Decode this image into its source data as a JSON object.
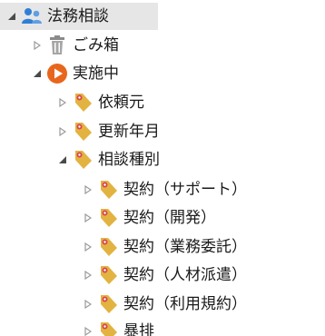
{
  "tree": {
    "root": {
      "label": "法務相談",
      "expanded": true,
      "icon": "users-icon"
    },
    "children": [
      {
        "label": "ごみ箱",
        "expanded": false,
        "icon": "trash-icon"
      },
      {
        "label": "実施中",
        "expanded": true,
        "icon": "play-circle-icon"
      }
    ],
    "active_children": [
      {
        "label": "依頼元",
        "expanded": false,
        "icon": "tag-icon"
      },
      {
        "label": "更新年月",
        "expanded": false,
        "icon": "tag-icon"
      },
      {
        "label": "相談種別",
        "expanded": true,
        "icon": "tag-icon"
      }
    ],
    "consult_types": [
      {
        "label": "契約（サポート）",
        "icon": "tag-icon"
      },
      {
        "label": "契約（開発）",
        "icon": "tag-icon"
      },
      {
        "label": "契約（業務委託）",
        "icon": "tag-icon"
      },
      {
        "label": "契約（人材派遣）",
        "icon": "tag-icon"
      },
      {
        "label": "契約（利用規約）",
        "icon": "tag-icon"
      },
      {
        "label": "暴排",
        "icon": "tag-icon"
      }
    ]
  },
  "colors": {
    "selection_bg": "#e6e6e6",
    "expander_filled": "#4a4a4a",
    "expander_outline": "#9a9a9a",
    "users_icon": "#2f7fd6",
    "play_icon": "#e8661c",
    "tag_icon": "#e3b341",
    "tag_dot": "#d9434f",
    "trash_icon": "#8a8a8a"
  }
}
